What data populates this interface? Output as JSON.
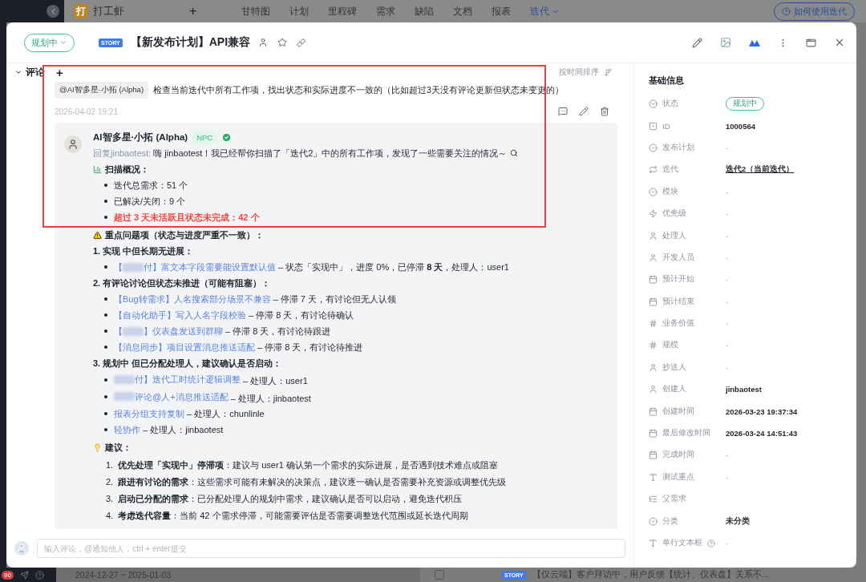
{
  "top_nav": {
    "logo": "打",
    "product": "打工虾",
    "add": "+",
    "tabs": [
      {
        "label": "甘特图",
        "selected": false
      },
      {
        "label": "计划",
        "selected": false
      },
      {
        "label": "里程碑",
        "selected": false
      },
      {
        "label": "需求",
        "selected": false
      },
      {
        "label": "缺陷",
        "selected": false
      },
      {
        "label": "文档",
        "selected": false
      },
      {
        "label": "报表",
        "selected": false
      },
      {
        "label": "迭代",
        "selected": true
      }
    ],
    "help": "如何使用迭代"
  },
  "modal": {
    "status": "规划中",
    "type_tag": "STORY",
    "title": "【新发布计划】API兼容",
    "starred": false
  },
  "comments": {
    "title": "评论",
    "add": "+",
    "sort": "按时间排序",
    "comment": {
      "mention": "@AI智多星·小拓 (Alpha)",
      "text": "检查当前迭代中所有工作项，找出状态和实际进度不一致的（比如超过3天没有评论更新但状态未变更的）",
      "time": "2026-04-02 19:21"
    },
    "reply": {
      "author": "AI智多星·小拓 (Alpha)",
      "tag": "NPC",
      "verified": true,
      "reply_to": "回复jinbaotest:",
      "greeting": "嗨 jinbaotest！我已经帮你扫描了「迭代2」中的所有工作项，发现了一些需要关注的情况～",
      "summary": {
        "heading": "扫描概况：",
        "items": [
          {
            "text": "迭代总需求：51 个",
            "alert": false
          },
          {
            "text": "已解决/关闭：9 个",
            "alert": false
          },
          {
            "text": "超过 3 天未活跃且状态未完成：42 个",
            "alert": true
          }
        ]
      },
      "issues": {
        "heading": "重点问题项（状态与进度严重不一致）：",
        "groups": [
          {
            "title": "1. 实现 中但长期无进展：",
            "items": [
              {
                "before": "【",
                "redacted": true,
                "after": "付】富文本字段需要能设置默认值",
                "rest": " – 状态「实现中」，进度 0%，已停滞 **8 天**，处理人：user1"
              }
            ]
          },
          {
            "title": "2. 有评论讨论但状态未推进（可能有阻塞）：",
            "items": [
              {
                "before": "【Bug转需求】人名搜索部分场景不兼容",
                "redacted": false,
                "rest": " – 停滞 7 天，有讨论但无人认领"
              },
              {
                "before": "【自动化助手】写入人名字段校验",
                "redacted": false,
                "rest": " – 停滞 8 天，有讨论待确认"
              },
              {
                "before": "【",
                "redacted": true,
                "after": "】仪表盘发送到群聊",
                "rest": " – 停滞 8 天，有讨论待跟进"
              },
              {
                "before": "【消息同步】项目设置消息推送适配",
                "redacted": false,
                "rest": " – 停滞 8 天，有讨论待推进"
              }
            ]
          },
          {
            "title": "3. 规划中 但已分配处理人，建议确认是否启动：",
            "items": [
              {
                "redacted": true,
                "after": "付】迭代工时统计逻辑调整",
                "rest": " – 处理人：user1"
              },
              {
                "redacted": true,
                "after": "评论@人+消息推送适配",
                "rest": " – 处理人：jinbaotest"
              },
              {
                "before": "报表分组支持复制",
                "redacted": false,
                "rest": " – 处理人：chunlinle"
              },
              {
                "before": "轻协作",
                "redacted": false,
                "rest": " – 处理人：jinbaotest"
              }
            ]
          }
        ]
      },
      "suggestions": {
        "heading": "建议：",
        "items": [
          {
            "number": "1.",
            "text": "**优先处理「实现中」停滞项**：建议与 user1 确认第一个需求的实际进展，是否遇到技术难点或阻塞"
          },
          {
            "number": "2.",
            "text": "**跟进有讨论的需求**：这些需求可能有未解决的决策点，建议逐一确认是否需要补充资源或调整优先级"
          },
          {
            "number": "3.",
            "text": "**启动已分配的需求**：已分配处理人的规划中需求，建议确认是否可以启动，避免迭代积压"
          },
          {
            "number": "4.",
            "text": "**考虑迭代容量**：当前 42 个需求停滞，可能需要评估是否需要调整迭代范围或延长迭代周期"
          }
        ]
      }
    },
    "input": {
      "placeholder": "输入评论，@通知他人，ctrl + enter提交"
    }
  },
  "info": {
    "title": "基础信息",
    "fields": [
      {
        "kind": "status",
        "label": "状态",
        "value": "规划中"
      },
      {
        "kind": "id",
        "label": "ID",
        "value": "1000564"
      },
      {
        "kind": "select",
        "label": "发布计划",
        "placeholder": "-"
      },
      {
        "kind": "iteration",
        "label": "迭代",
        "value": "迭代2（当前迭代）"
      },
      {
        "kind": "select",
        "label": "模块",
        "placeholder": "-"
      },
      {
        "kind": "priority",
        "label": "优先级",
        "placeholder": "-"
      },
      {
        "kind": "user",
        "label": "处理人",
        "placeholder": "-"
      },
      {
        "kind": "user",
        "label": "开发人员",
        "placeholder": "-"
      },
      {
        "kind": "date",
        "label": "预计开始",
        "placeholder": "-"
      },
      {
        "kind": "date",
        "label": "预计结束",
        "placeholder": "-"
      },
      {
        "kind": "number",
        "label": "业务价值",
        "placeholder": "-"
      },
      {
        "kind": "number",
        "label": "规模",
        "placeholder": "-"
      },
      {
        "kind": "user",
        "label": "抄送人",
        "placeholder": "-"
      },
      {
        "kind": "user",
        "label": "创建人",
        "value": "jinbaotest"
      },
      {
        "kind": "date",
        "label": "创建时间",
        "value": "2026-03-23 19:37:34"
      },
      {
        "kind": "date",
        "label": "最后修改时间",
        "value": "2026-03-24 14:51:43"
      },
      {
        "kind": "date",
        "label": "完成时间",
        "placeholder": "-"
      },
      {
        "kind": "text",
        "label": "测试重点",
        "placeholder": "-"
      },
      {
        "kind": "tree",
        "label": "父需求"
      },
      {
        "kind": "select",
        "label": "分类",
        "value": "未分类"
      },
      {
        "kind": "text",
        "label": "单行文本框",
        "placeholder": "-",
        "help": true
      }
    ]
  },
  "background": {
    "badge": "90",
    "date_range": "2024-12-27 ~ 2025-01-03",
    "row": {
      "checked": false,
      "tag": "STORY",
      "title": "【仅云端】客户拜访中，用户反馈【统计、仪表盘】关系不..."
    }
  }
}
